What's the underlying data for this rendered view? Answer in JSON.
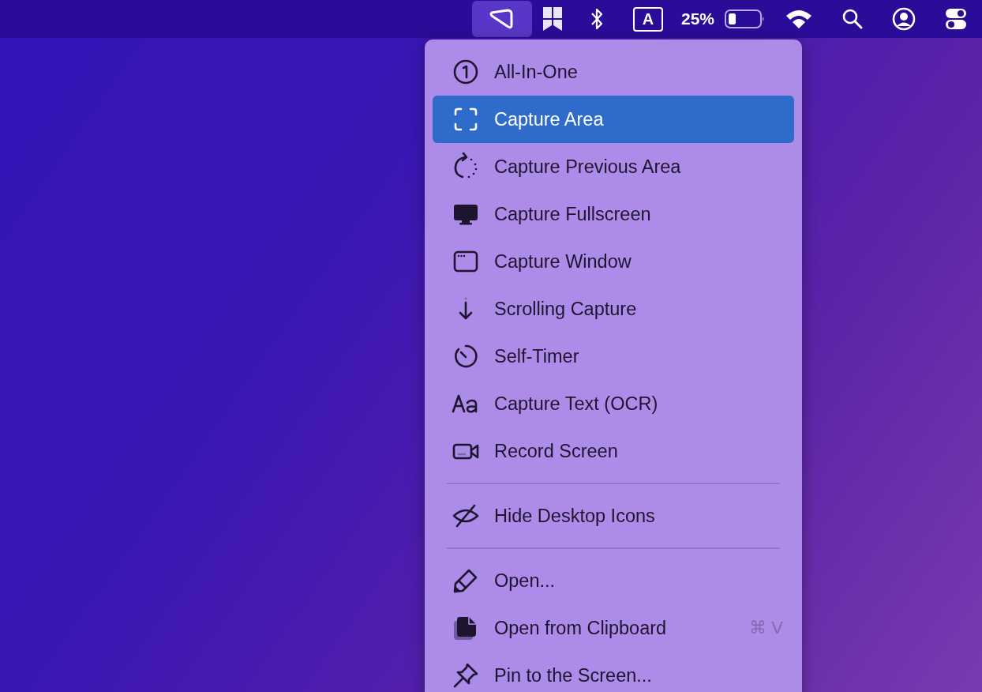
{
  "menu_bar": {
    "items": [
      {
        "kind": "icon",
        "selected": true
      },
      {
        "kind": "icon",
        "selected": false
      },
      {
        "kind": "icon",
        "selected": false
      },
      {
        "kind": "boxed",
        "text": "A",
        "selected": false
      },
      {
        "kind": "text",
        "text": "25%",
        "selected": false
      },
      {
        "kind": "icon",
        "selected": false
      },
      {
        "kind": "icon",
        "selected": false
      },
      {
        "kind": "icon",
        "selected": false
      },
      {
        "kind": "icon",
        "selected": false
      },
      {
        "kind": "icon",
        "selected": false
      }
    ]
  },
  "menu": {
    "sections": [
      [
        {
          "label": "All-In-One",
          "selected": false
        },
        {
          "label": "Capture Area",
          "selected": true
        },
        {
          "label": "Capture Previous Area",
          "selected": false
        },
        {
          "label": "Capture Fullscreen",
          "selected": false
        },
        {
          "label": "Capture Window",
          "selected": false
        },
        {
          "label": "Scrolling Capture",
          "selected": false
        },
        {
          "label": "Self-Timer",
          "selected": false
        },
        {
          "label": "Capture Text (OCR)",
          "selected": false
        },
        {
          "label": "Record Screen",
          "selected": false
        }
      ],
      [
        {
          "label": "Hide Desktop Icons",
          "selected": false
        }
      ],
      [
        {
          "label": "Open...",
          "selected": false
        },
        {
          "label": "Open from Clipboard",
          "shortcut": "⌘ V",
          "selected": false
        },
        {
          "label": "Pin to the Screen...",
          "selected": false
        }
      ]
    ]
  }
}
